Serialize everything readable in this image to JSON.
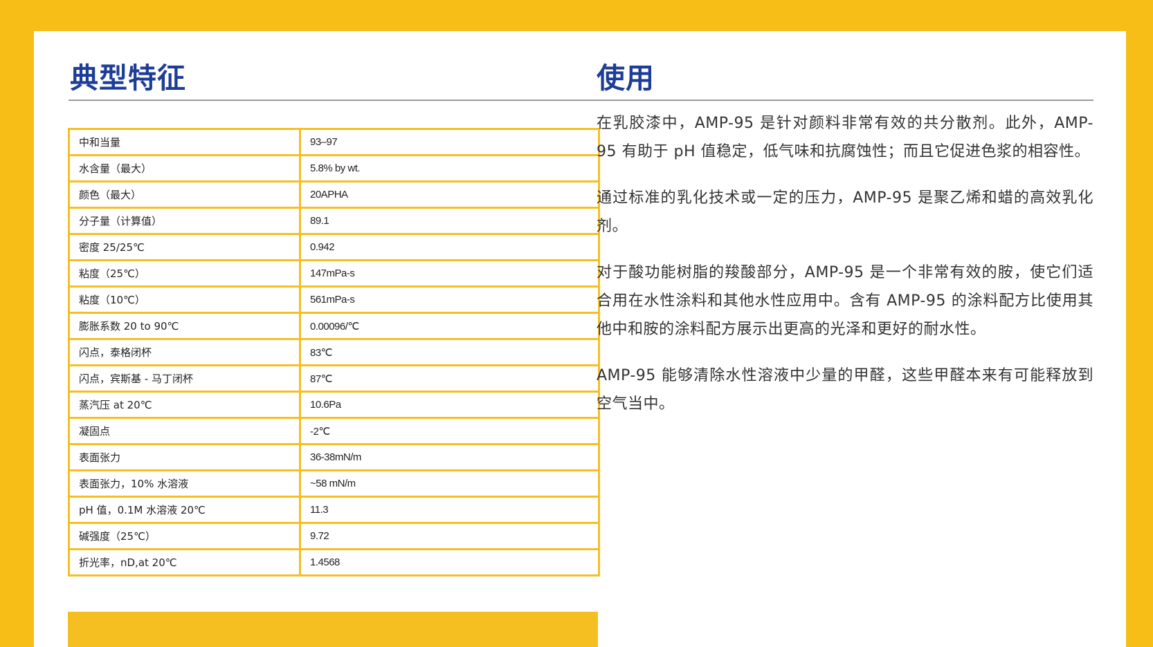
{
  "left": {
    "title": "典型特征",
    "rows": [
      {
        "label": "中和当量",
        "value": "93–97"
      },
      {
        "label": "水含量（最大）",
        "value": "5.8% by wt."
      },
      {
        "label": "颜色（最大）",
        "value": "20APHA"
      },
      {
        "label": "分子量（计算值）",
        "value": "89.1"
      },
      {
        "label": "密度 25/25℃",
        "value": "0.942"
      },
      {
        "label": "粘度（25℃）",
        "value": "147mPa-s"
      },
      {
        "label": "粘度（10℃）",
        "value": "561mPa-s"
      },
      {
        "label": "膨胀系数 20 to 90℃",
        "value": "0.00096/℃"
      },
      {
        "label": "闪点，泰格闭杯",
        "value": "83℃"
      },
      {
        "label": "闪点，宾斯基 - 马丁闭杯",
        "value": "87℃"
      },
      {
        "label": "蒸汽压 at 20℃",
        "value": "10.6Pa"
      },
      {
        "label": "凝固点",
        "value": "-2℃"
      },
      {
        "label": "表面张力",
        "value": "36-38mN/m"
      },
      {
        "label": "表面张力，10% 水溶液",
        "value": "~58 mN/m"
      },
      {
        "label": "pH 值，0.1M 水溶液 20℃",
        "value": "11.3"
      },
      {
        "label": "碱强度（25℃）",
        "value": "9.72"
      },
      {
        "label": "折光率，nD,at 20℃",
        "value": "1.4568"
      }
    ]
  },
  "right": {
    "title": "使用",
    "paragraphs": [
      "在乳胶漆中，AMP-95 是针对颜料非常有效的共分散剂。此外，AMP-95 有助于 pH 值稳定，低气味和抗腐蚀性；而且它促进色浆的相容性。",
      "通过标准的乳化技术或一定的压力，AMP-95 是聚乙烯和蜡的高效乳化剂。",
      "对于酸功能树脂的羧酸部分，AMP-95 是一个非常有效的胺，使它们适合用在水性涂料和其他水性应用中。含有 AMP-95 的涂料配方比使用其他中和胺的涂料配方展示出更高的光泽和更好的耐水性。",
      "AMP-95 能够清除水性溶液中少量的甲醛，这些甲醛本来有可能释放到空气当中。"
    ]
  },
  "colors": {
    "frame": "#F7BE18",
    "title": "#1E3D96",
    "table_border": "#F5BF22",
    "rule": "#9A9A9A"
  }
}
